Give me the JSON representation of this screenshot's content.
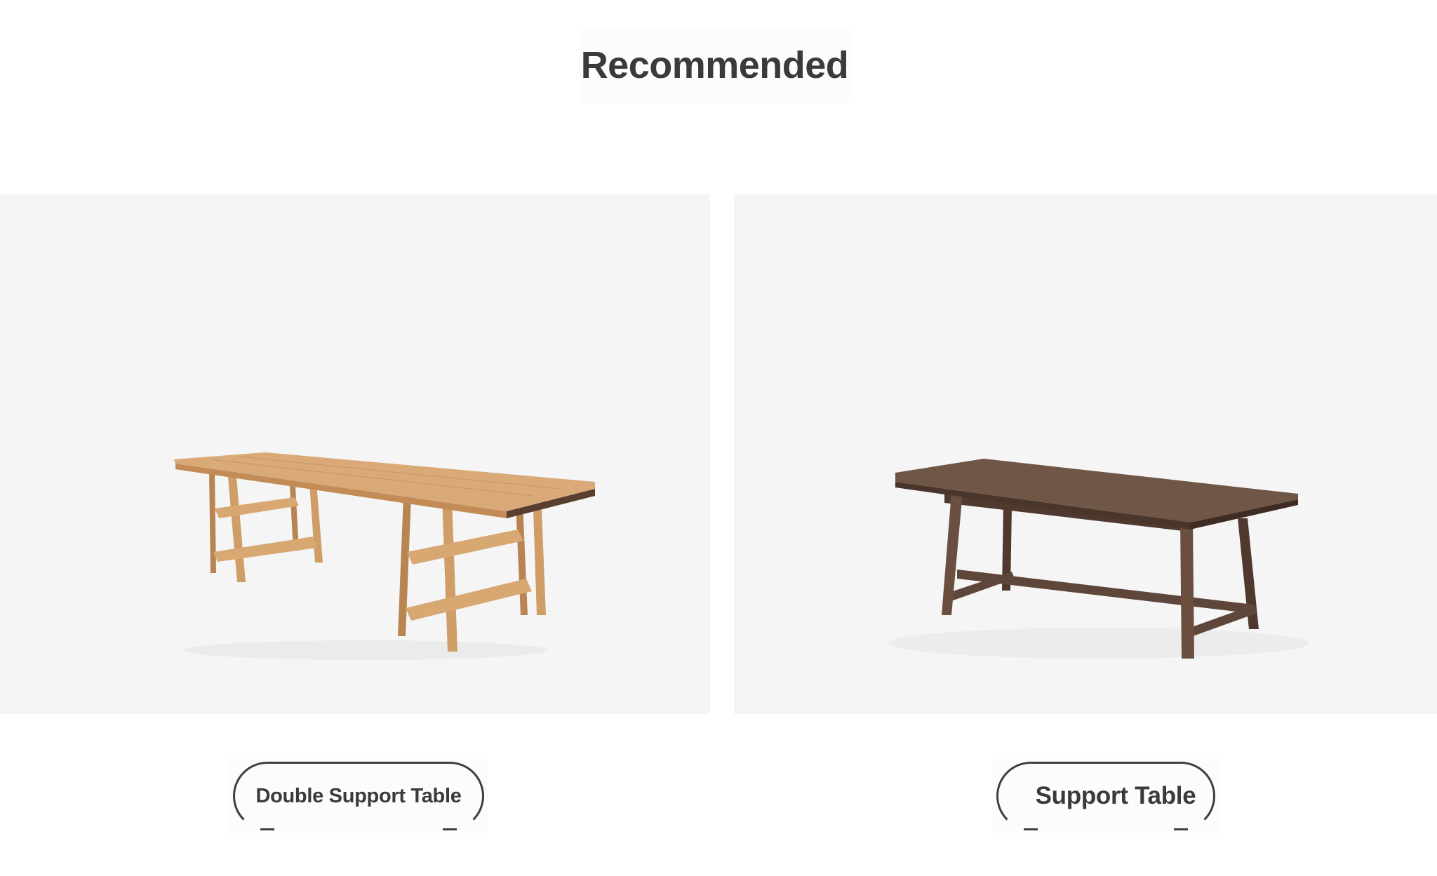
{
  "section": {
    "title": "Recommended"
  },
  "products": [
    {
      "name": "Double Support Table",
      "image_icon": "double-support-table-image",
      "wood_color": "#c99a68"
    },
    {
      "name": "Support Table",
      "image_icon": "support-table-image",
      "wood_color": "#5e463a"
    }
  ],
  "colors": {
    "text": "#3a3a3a",
    "image_background": "#f5f5f5",
    "pill_border": "#3f3f3f"
  }
}
